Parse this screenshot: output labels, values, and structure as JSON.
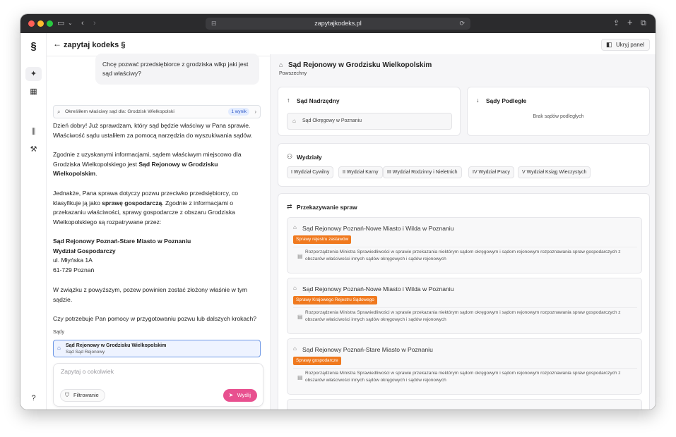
{
  "browser": {
    "url": "zapytajkodeks.pl"
  },
  "rail": {
    "logo": "§"
  },
  "chat": {
    "title": "zapytaj kodeks §",
    "user_message": "Chcę pozwać przedsiębiorce z grodziska wlkp jaki jest sąd właściwy?",
    "tool_call": {
      "text": "Określiłem właściwy sąd dla: Grodzisk Wielkopolski",
      "badge": "1 wynik"
    },
    "reply": {
      "p1": "Dzień dobry! Już sprawdzam, który sąd będzie właściwy w Pana sprawie. Właściwość sądu ustaliłem za pomocą narzędzia do wyszukiwania sądów.",
      "p2_pre": "Zgodnie z uzyskanymi informacjami, sądem właściwym miejscowo dla Grodziska Wielkopolskiego jest ",
      "p2_bold": "Sąd Rejonowy w Grodzisku Wielkopolskim",
      "p2_post": ".",
      "p3_pre": "Jednakże, Pana sprawa dotyczy pozwu przeciwko przedsiębiorcy, co klasyfikuje ją jako ",
      "p3_bold": "sprawę gospodarczą",
      "p3_post": ". Zgodnie z informacjami o przekazaniu właściwości, sprawy gospodarcze z obszaru Grodziska Wielkopolskiego są rozpatrywane przez:",
      "addr_name": "Sąd Rejonowy Poznań-Stare Miasto w Poznaniu",
      "addr_dept": "Wydział Gospodarczy",
      "addr_street": "ul. Młyńska 1A",
      "addr_city": "61-729 Poznań",
      "p4": "W związku z powyższym, pozew powinien zostać złożony właśnie w tym sądzie.",
      "p5": "Czy potrzebuje Pan pomocy w przygotowaniu pozwu lub dalszych krokach?"
    },
    "sources_label": "Sądy",
    "source_card": {
      "name": "Sąd Rejonowy w Grodzisku Wielkopolskim",
      "sub": "Sąd Sąd Rejonowy"
    },
    "composer": {
      "placeholder": "Zapytaj o cokolwiek",
      "filter_label": "Filtrowanie",
      "send_label": "Wyślij"
    }
  },
  "panel": {
    "hide_label": "Ukryj panel",
    "court_name": "Sąd Rejonowy w Grodzisku Wielkopolskim",
    "court_type": "Powszechny",
    "superior": {
      "heading": "Sąd Nadrzędny",
      "value": "Sąd Okręgowy w Poznaniu"
    },
    "subordinate": {
      "heading": "Sądy Podległe",
      "empty": "Brak sądów podległych"
    },
    "departments": {
      "heading": "Wydziały",
      "items": [
        "I Wydział Cywilny",
        "II Wydział Karny",
        "III Wydział Rodzinny i Nieletnich",
        "IV Wydział Pracy",
        "V Wydział Ksiąg Wieczystych"
      ]
    },
    "transfers": {
      "heading": "Przekazywanie spraw",
      "items": [
        {
          "court": "Sąd Rejonowy Poznań-Nowe Miasto i Wilda w Poznaniu",
          "tag": "Sprawy rejestru zastawów",
          "desc": "Rozporządzenia Ministra Sprawiedliwości w sprawie przekazania niektórym sądom okręgowym i sądom rejonowym rozpoznawania spraw gospodarczych z obszarów właściwości innych sądów okręgowych i sądów rejonowych"
        },
        {
          "court": "Sąd Rejonowy Poznań-Nowe Miasto i Wilda w Poznaniu",
          "tag": "Sprawy Krajowego Rejestru Sądowego",
          "desc": "Rozporządzenia Ministra Sprawiedliwości w sprawie przekazania niektórym sądom okręgowym i sądom rejonowym rozpoznawania spraw gospodarczych z obszarów właściwości innych sądów okręgowych i sądów rejonowych"
        },
        {
          "court": "Sąd Rejonowy Poznań-Stare Miasto w Poznaniu",
          "tag": "Sprawy gospodarcze",
          "desc": "Rozporządzenia Ministra Sprawiedliwości w sprawie przekazania niektórym sądom okręgowym i sądom rejonowym rozpoznawania spraw gospodarczych z obszarów właściwości innych sądów okręgowych i sądów rejonowych"
        }
      ]
    }
  },
  "colors": {
    "accent_pink": "#e8508f",
    "tag_orange": "#f0791e",
    "selected_blue": "#6e98e6"
  }
}
